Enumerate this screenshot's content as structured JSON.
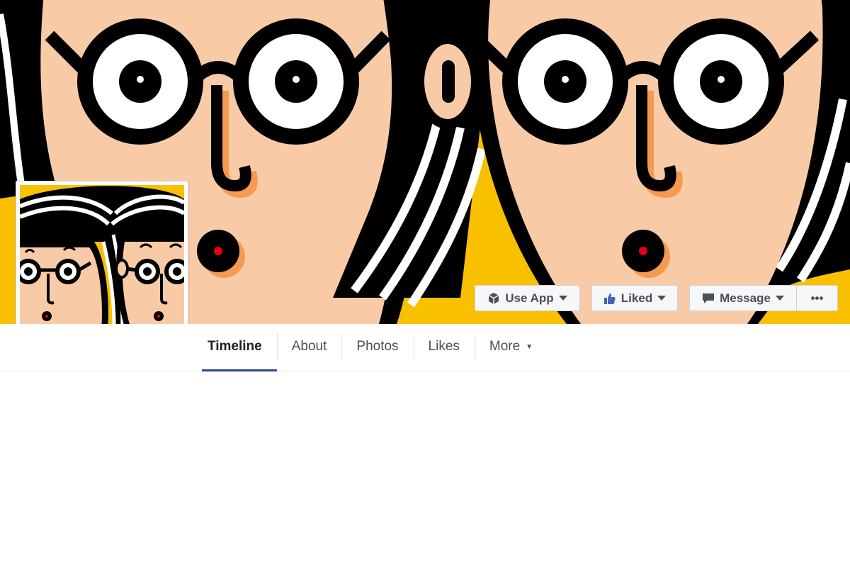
{
  "cover": {
    "background_color": "#f9c000",
    "skin_color": "#f8cba6",
    "outline_color": "#000000",
    "accent_color": "#e60012"
  },
  "actions": {
    "use_app_label": "Use App",
    "liked_label": "Liked",
    "message_label": "Message",
    "more_label": "•••",
    "icons": {
      "use_app": "cube-icon",
      "liked": "thumbs-up-icon",
      "message": "speech-bubble-icon",
      "caret": "caret-down-icon"
    },
    "liked_icon_color": "#4267b2"
  },
  "tabs": [
    {
      "label": "Timeline",
      "active": true
    },
    {
      "label": "About",
      "active": false
    },
    {
      "label": "Photos",
      "active": false
    },
    {
      "label": "Likes",
      "active": false
    },
    {
      "label": "More",
      "active": false,
      "has_dropdown": true
    }
  ],
  "active_tab_color": "#2a4b8d"
}
